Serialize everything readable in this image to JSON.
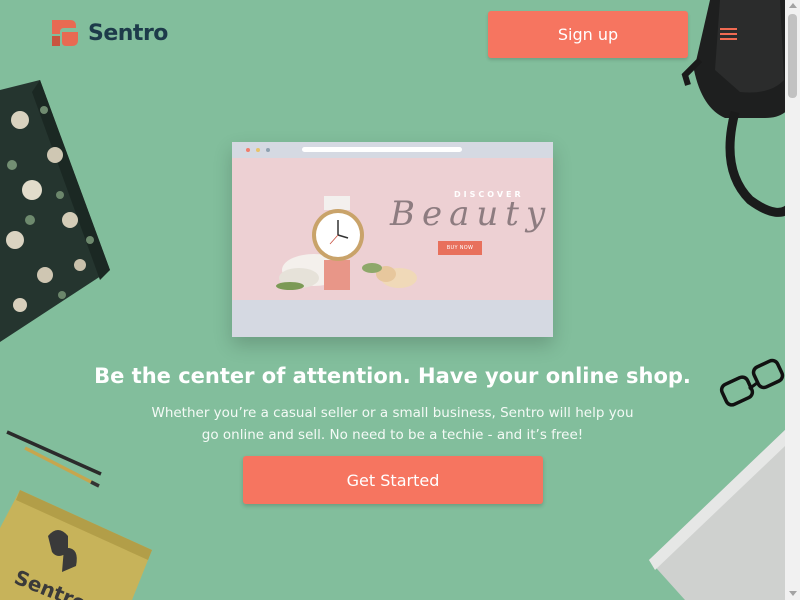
{
  "header": {
    "logo_text": "Sentro",
    "logo_icon": "sentro-logo-icon",
    "signup_label": "Sign up",
    "menu_icon": "hamburger-menu-icon"
  },
  "mockup": {
    "discover_text": "DISCOVER",
    "beauty_text": "Beauty",
    "buy_now_label": "BUY NOW"
  },
  "hero": {
    "headline": "Be the center of attention. Have your online shop.",
    "subtext_line1": "Whether you’re a casual seller or a small business, Sentro will help you",
    "subtext_line2": "go online and sell. No need to be a techie - and it’s free!",
    "cta_label": "Get Started"
  },
  "decor": {
    "notebook_text": "Sentro"
  },
  "colors": {
    "background": "#82be9c",
    "accent": "#f67560",
    "logo_text": "#1d3b4a",
    "banner": "#edd0d3"
  }
}
